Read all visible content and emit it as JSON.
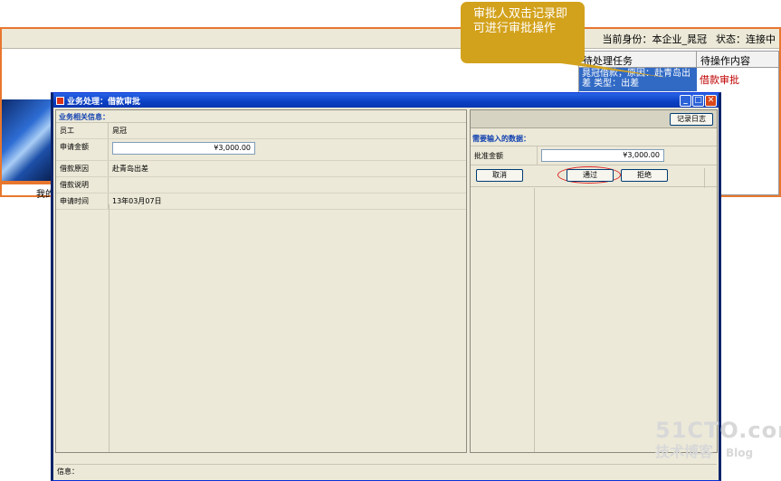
{
  "background_app": {
    "status_identity_label": "当前身份：本企业_晁冠",
    "status_state_label": "状态：连接中",
    "task_panel": {
      "col_task": "待处理任务",
      "col_action": "待操作内容",
      "rows": [
        {
          "task": "晁冠借款，原因：赴青岛出差 类型：出差",
          "action": "借款审批"
        }
      ]
    },
    "tab_label": "我的"
  },
  "callout": {
    "text": "审批人双击记录即可进行审批操作"
  },
  "dialog": {
    "title": "业务处理：借款审批",
    "left": {
      "section_label": "业务相关信息：",
      "fields": [
        {
          "label": "员工",
          "value": "晁冠"
        },
        {
          "label": "申请金额",
          "value": "¥3,000.00"
        },
        {
          "label": "借款原因",
          "value": "赴青岛出差"
        },
        {
          "label": "借款说明",
          "value": ""
        },
        {
          "label": "申请时间",
          "value": "13年03月07日"
        }
      ]
    },
    "right": {
      "log_button": "记录日志",
      "need_label": "需要输入的数据：",
      "approve_label": "批准金额",
      "approve_value": "¥3,000.00",
      "cancel_button": "取消",
      "approve_button": "通过",
      "reject_button": "拒绝"
    },
    "info_label": "信息："
  },
  "watermark": {
    "main": "51CTO.com",
    "sub": "技术博客",
    "blog": "Blog"
  },
  "colors": {
    "accent_orange": "#e8772e",
    "titlebar_blue": "#0a3fc4",
    "callout_gold": "#d3a21c",
    "section_blue": "#1040b0",
    "alert_red": "#c00000"
  }
}
